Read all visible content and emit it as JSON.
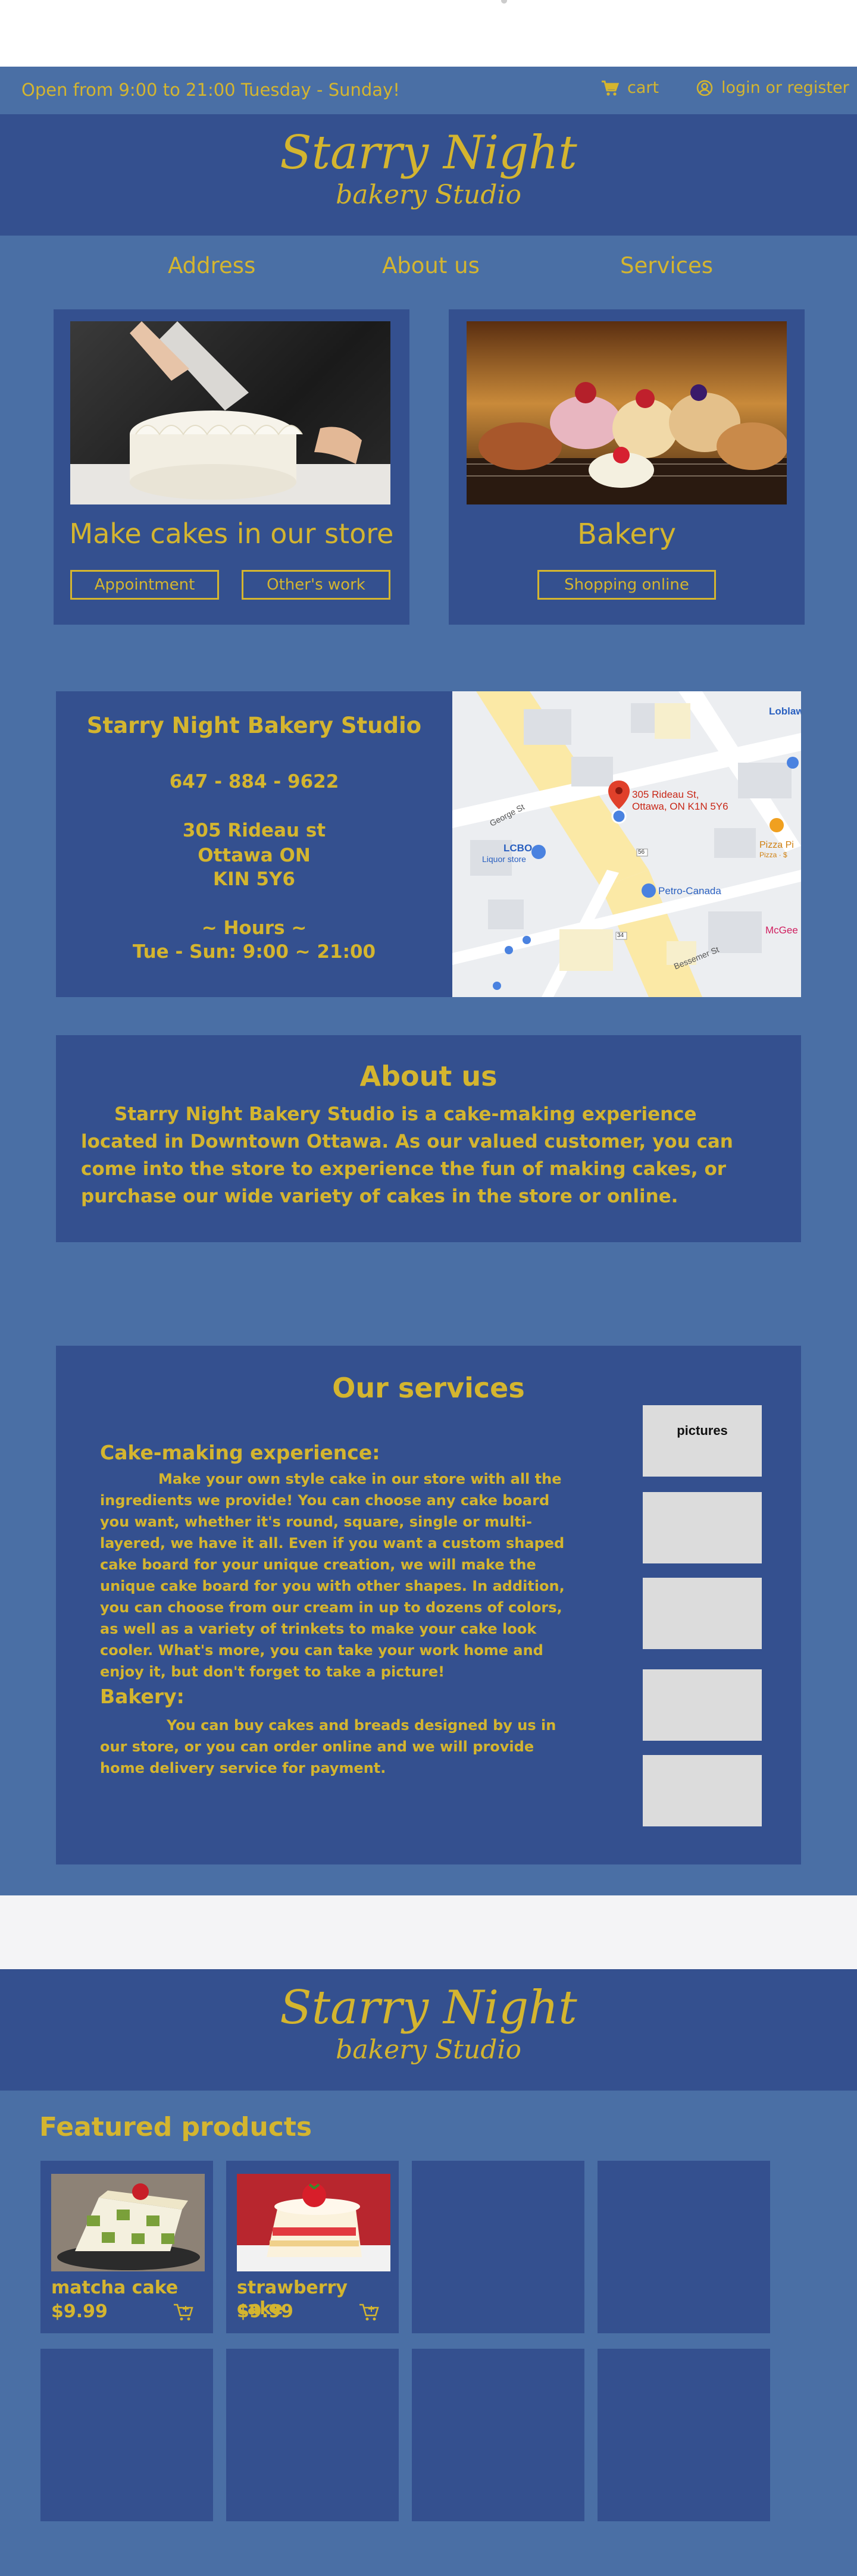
{
  "topbar": {
    "hours_text": "Open from 9:00 to 21:00 Tuesday - Sunday!",
    "cart_label": "cart",
    "login_label": "login or register"
  },
  "brand": {
    "title": "Starry Night",
    "subtitle": "bakery Studio"
  },
  "nav": {
    "items": [
      {
        "label": "Address"
      },
      {
        "label": "About us"
      },
      {
        "label": "Services"
      }
    ]
  },
  "cards": {
    "store": {
      "title": "Make cakes in our store",
      "button1": "Appointment",
      "button2": "Other's work"
    },
    "bakery": {
      "title": "Bakery",
      "button": "Shopping online"
    }
  },
  "address": {
    "name": "Starry Night Bakery Studio",
    "phone": "647 - 884 - 9622",
    "street": "305 Rideau st",
    "city": "Ottawa ON",
    "postal": "KIN 5Y6",
    "hours_heading": "~ Hours ~",
    "hours": "Tue - Sun: 9:00 ~ 21:00"
  },
  "map": {
    "pin_label_line1": "305 Rideau St,",
    "pin_label_line2": "Ottawa, ON K1N 5Y6",
    "lcbo": "LCBO",
    "lcbo_sub": "Liquor store",
    "petro": "Petro-Canada",
    "pizza": "Pizza Pi",
    "pizza_sub": "Pizza · $",
    "mcgee": "McGee",
    "loblaws": "Loblaw",
    "street_george": "George St",
    "street_bessemer": "Bessemer St",
    "route_56": "56",
    "route_34": "34"
  },
  "about": {
    "heading": "About us",
    "body": "Starry Night Bakery Studio is a cake-making experience located in Downtown Ottawa. As our valued customer, you can come into the store to experience the fun of making cakes, or purchase our wide variety of cakes in the store or online."
  },
  "services": {
    "heading": "Our services",
    "cake_heading": "Cake-making experience:",
    "cake_body": "Make your own style cake in our store with all the ingredients we provide! You can choose any cake board you want, whether it's round, square, single or multi-layered, we have it all. Even if you want a custom shaped cake board for your unique creation, we will make the unique cake board for you with other shapes. In addition, you can choose from our cream in up to dozens of colors, as well as a variety of trinkets to make your cake look cooler. What's more, you can take your work home and enjoy it, but don't forget to take a picture!",
    "bakery_heading": "Bakery:",
    "bakery_body": "You can buy cakes and breads designed by us in our store, or you can order online and we will provide home delivery service for payment.",
    "pictures_label": "pictures"
  },
  "featured": {
    "heading": "Featured products",
    "products": [
      {
        "name": "matcha cake",
        "price": "$9.99"
      },
      {
        "name": "strawberry cake",
        "price": "$9.99"
      }
    ]
  },
  "colors": {
    "dark_blue": "#34508f",
    "mid_blue": "#4a6fa5",
    "gold": "#d4b52f"
  }
}
